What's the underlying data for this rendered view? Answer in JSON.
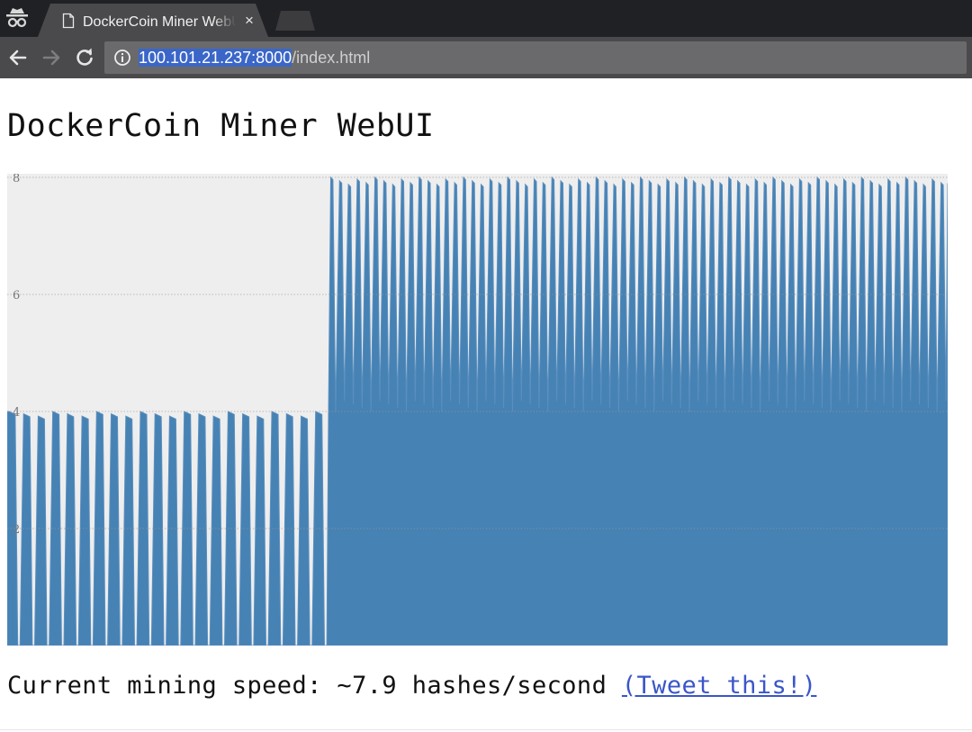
{
  "browser": {
    "tab_title": "DockerCoin Miner WebUI",
    "tab_close_glyph": "×",
    "url_host": "100.101.21.237:8000",
    "url_path": "/index.html",
    "icons": {
      "incognito": "incognito-icon",
      "tab_page": "document-icon",
      "back": "back-arrow-icon",
      "forward": "forward-arrow-icon",
      "reload": "reload-icon",
      "info": "info-icon"
    }
  },
  "page": {
    "title": "DockerCoin Miner WebUI",
    "speed_prefix": "Current mining speed: ",
    "speed_value": "~7.9",
    "speed_unit": " hashes/second ",
    "tweet_label": "(Tweet this!)"
  },
  "chart_data": {
    "type": "area",
    "ylim": [
      0,
      8
    ],
    "y_ticks": [
      "2",
      "4",
      "6",
      "8"
    ],
    "grid": true,
    "colors": {
      "fill": "#4682b4",
      "background": "#eeeeee",
      "grid": "#999999"
    },
    "segments": [
      {
        "description": "cycles oscillating between ~0 and ~4 hashes/second",
        "high": 4,
        "low": 0,
        "count": 22
      },
      {
        "description": "cycles oscillating between ~4 and ~8 hashes/second",
        "high": 8,
        "low": 4,
        "count": 70
      }
    ]
  }
}
